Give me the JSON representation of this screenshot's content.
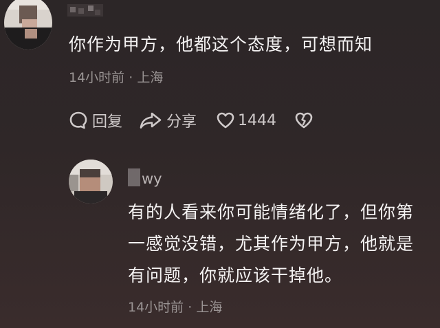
{
  "comment": {
    "text": "你作为甲方，他都这个态度，可想而知",
    "time": "14小时前",
    "location": "上海",
    "actions": {
      "reply_label": "回复",
      "share_label": "分享",
      "like_count": "1444"
    }
  },
  "reply": {
    "username": "wy",
    "text_lines": [
      "有的人看来你可能情绪化了，但你第",
      "一感觉没错，尤其作为甲方，他就是",
      "有问题，你就应该干掉他。"
    ],
    "time": "14小时前",
    "location": "上海"
  },
  "icons": {
    "reply": "speech-bubble-icon",
    "share": "share-arrow-icon",
    "like": "heart-outline-icon",
    "dislike": "broken-heart-icon"
  }
}
